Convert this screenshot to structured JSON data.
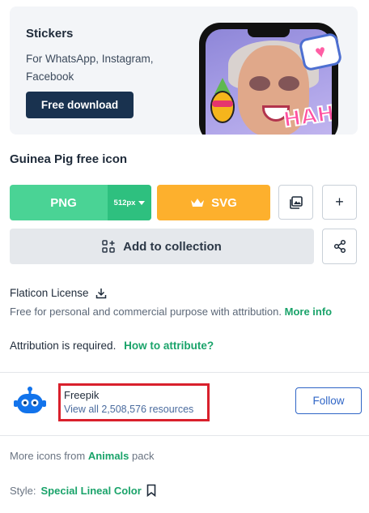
{
  "promo": {
    "title": "Stickers",
    "subtitle": "For WhatsApp, Instagram, Facebook",
    "button": "Free download",
    "sticker_text": "HAHA"
  },
  "icon": {
    "title": "Guinea Pig free icon"
  },
  "download": {
    "png_label": "PNG",
    "png_size": "512px",
    "svg_label": "SVG",
    "plus_label": "+",
    "add_collection_label": "Add to collection"
  },
  "license": {
    "title": "Flaticon License",
    "description": "Free for personal and commercial purpose with attribution.",
    "more_info": "More info",
    "attribution_text": "Attribution is required.",
    "how_to_attribute": "How to attribute?"
  },
  "author": {
    "name": "Freepik",
    "resources": "View all 2,508,576 resources",
    "follow_label": "Follow"
  },
  "pack": {
    "prefix": "More icons from",
    "name": "Animals",
    "suffix": "pack"
  },
  "style": {
    "label": "Style:",
    "name": "Special Lineal Color"
  },
  "colors": {
    "png_green": "#4ad395",
    "svg_orange": "#fdb02d",
    "link_green": "#1aa36a",
    "follow_blue": "#2f65c6",
    "highlight_red": "#d9202c"
  }
}
